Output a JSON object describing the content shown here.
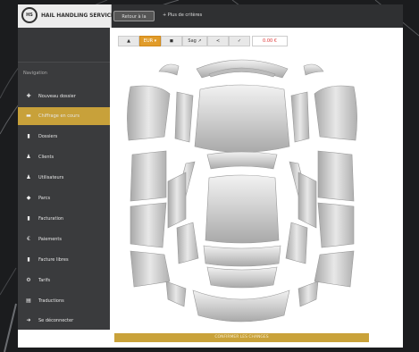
{
  "header": {
    "logo_circle": "HS",
    "logo_text": "HAIL HANDLING SERVICES",
    "back_button": "Retour à la",
    "more_criteria": "+ Plus de critères"
  },
  "sidebar": {
    "user_name": "",
    "user_role": "",
    "nav_title": "Navigation",
    "items": [
      {
        "label": "Nouveau dossier",
        "icon": "plus-icon"
      },
      {
        "label": "Chiffrage en cours",
        "icon": "car-icon",
        "active": true
      },
      {
        "label": "Dossiers",
        "icon": "file-icon"
      },
      {
        "label": "Clients",
        "icon": "user-icon"
      },
      {
        "label": "Utilisateurs",
        "icon": "user-icon"
      },
      {
        "label": "Parcs",
        "icon": "tag-icon"
      },
      {
        "label": "Facturation",
        "icon": "file-icon"
      },
      {
        "label": "Paiements",
        "icon": "euro-icon"
      },
      {
        "label": "Facture libres",
        "icon": "file-icon"
      },
      {
        "label": "Tarifs",
        "icon": "gear-icon"
      },
      {
        "label": "Traductions",
        "icon": "book-icon"
      },
      {
        "label": "Se déconnecter",
        "icon": "logout-icon"
      }
    ]
  },
  "toolbar": {
    "buttons": [
      {
        "label": "▲",
        "name": "user-icon-button"
      },
      {
        "label": "EUR ▾",
        "name": "currency-button",
        "active": true
      },
      {
        "label": "◼",
        "name": "car-icon-button"
      },
      {
        "label": "Sag ↗",
        "name": "sag-button"
      },
      {
        "label": "≺",
        "name": "share-icon-button"
      },
      {
        "label": "✓",
        "name": "check-icon-button"
      }
    ],
    "price": "0.00 €"
  },
  "footer": {
    "save_button": "CONFIRMER LES CHANGES"
  },
  "colors": {
    "accent": "#c8a13a",
    "sidebar_bg": "#3a3b3d",
    "active_toolbar": "#e19c2a",
    "price_red": "#d33333"
  }
}
